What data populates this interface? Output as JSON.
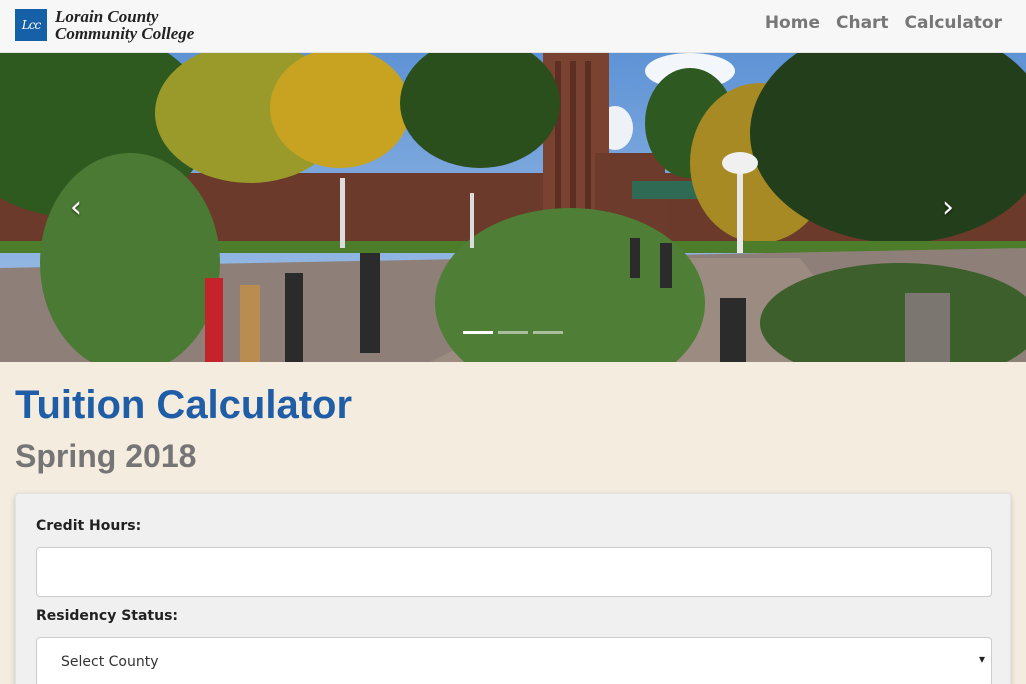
{
  "header": {
    "logo_text": "Lcc",
    "brand_line1": "Lorain County",
    "brand_line2": "Community College",
    "nav": [
      {
        "label": "Home"
      },
      {
        "label": "Chart"
      },
      {
        "label": "Calculator"
      }
    ]
  },
  "carousel": {
    "prev_icon": "chevron-left-icon",
    "next_icon": "chevron-right-icon",
    "prev_glyph": "‹",
    "next_glyph": "›",
    "slide_count": 3,
    "active_index": 0
  },
  "main": {
    "title": "Tuition Calculator",
    "subtitle": "Spring 2018"
  },
  "form": {
    "credit_hours_label": "Credit Hours:",
    "credit_hours_value": "",
    "residency_label": "Residency Status:",
    "residency_selected": "Select County",
    "caret_glyph": "▾"
  },
  "colors": {
    "brand_blue": "#1660a8",
    "title_blue": "#1f5da6",
    "page_background": "#f4ecdf"
  }
}
